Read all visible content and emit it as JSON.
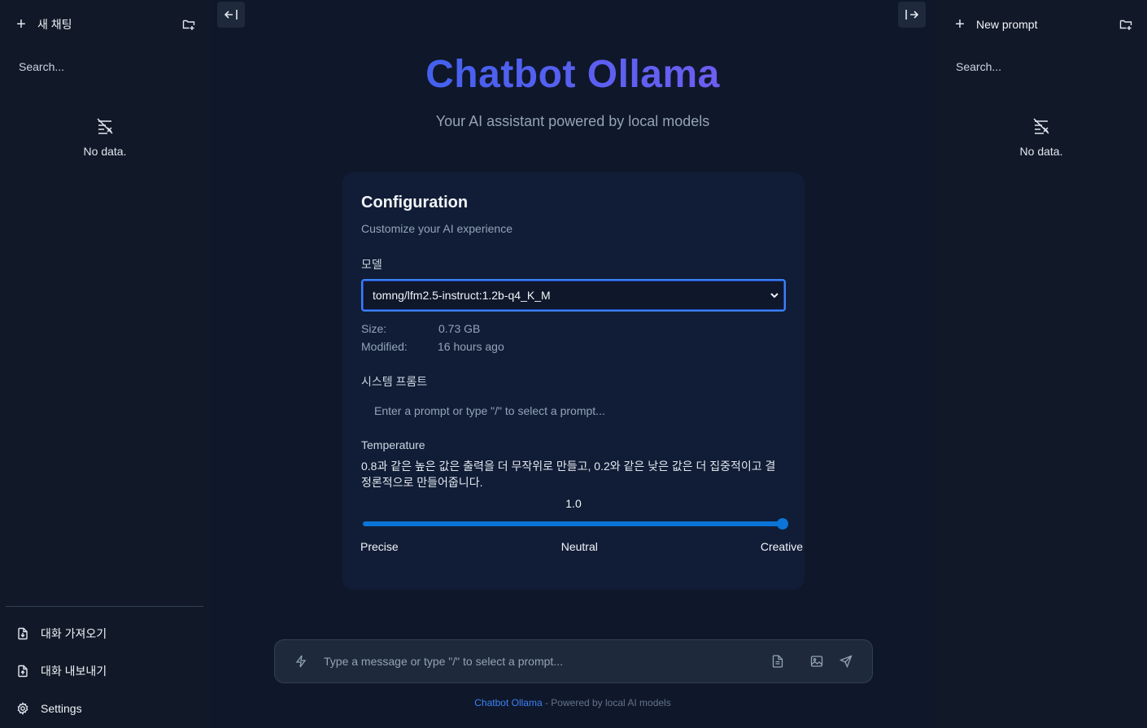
{
  "left_sidebar": {
    "new_chat_label": "새 채팅",
    "search_placeholder": "Search...",
    "empty_text": "No data.",
    "bottom_items": [
      {
        "label": "대화 가져오기",
        "icon": "import-file-icon"
      },
      {
        "label": "대화 내보내기",
        "icon": "export-file-icon"
      },
      {
        "label": "Settings",
        "icon": "gear-icon"
      }
    ]
  },
  "right_sidebar": {
    "new_prompt_label": "New prompt",
    "search_placeholder": "Search...",
    "empty_text": "No data."
  },
  "header": {
    "title": "Chatbot Ollama",
    "subtitle": "Your AI assistant powered by local models"
  },
  "config": {
    "title": "Configuration",
    "subtitle": "Customize your AI experience",
    "model_label": "모델",
    "model_selected": "tomng/lfm2.5-instruct:1.2b-q4_K_M",
    "size_key": "Size:",
    "size_val": "0.73 GB",
    "modified_key": "Modified:",
    "modified_val": "16 hours ago",
    "system_prompt_label": "시스템 프롬트",
    "system_prompt_placeholder": "Enter a prompt or type \"/\" to select a prompt...",
    "temperature_label": "Temperature",
    "temperature_desc": "0.8과 같은 높은 값은 출력을 더 무작위로 만들고, 0.2와 같은 낮은 값은 더 집중적이고 결정론적으로 만들어줍니다.",
    "temperature_value": "1.0",
    "temperature_fraction": 1.0,
    "scale_precise": "Precise",
    "scale_neutral": "Neutral",
    "scale_creative": "Creative"
  },
  "message_bar": {
    "placeholder": "Type a message or type \"/\" to select a prompt..."
  },
  "footer": {
    "brand": "Chatbot Ollama",
    "rest": " - Powered by local AI models"
  },
  "colors": {
    "background": "#0f172a",
    "sidebar": "#111827",
    "card": "#111d36",
    "accent": "#3b82f6",
    "slider": "#0b74d6"
  }
}
